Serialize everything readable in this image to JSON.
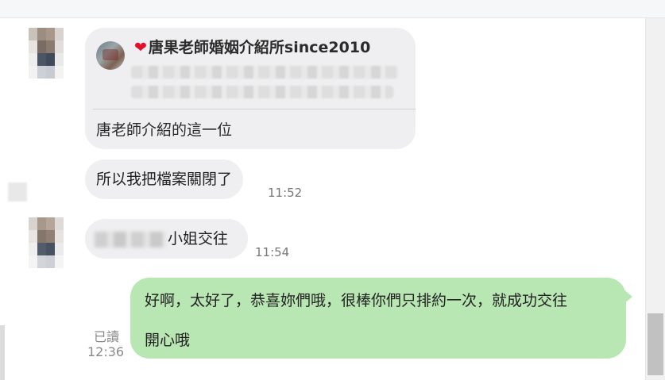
{
  "messages": {
    "shared_card": {
      "heart_icon": "❤",
      "title": "唐果老師婚姻介紹所since2010",
      "caption": "唐老師介紹的這一位"
    },
    "msg2": {
      "text": "所以我把檔案關閉了",
      "time": "11:52"
    },
    "msg3": {
      "text": "小姐交往",
      "time": "11:54"
    },
    "outgoing": {
      "line1": "好啊，太好了，恭喜妳們哦，很棒你們只排約一次，就成功交往",
      "line2": "開心哦",
      "read_label": "已讀",
      "time": "12:36",
      "bubble_color": "#b9e7b3"
    }
  }
}
